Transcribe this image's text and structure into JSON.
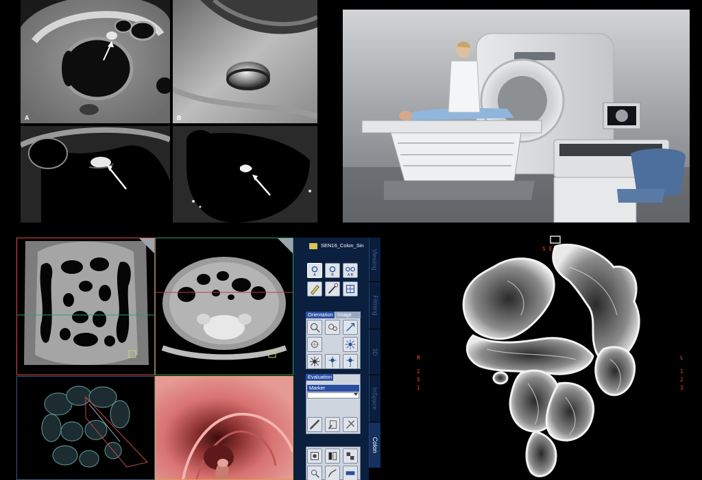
{
  "top_left_panels": {
    "label_a": "A",
    "label_b": "B"
  },
  "viewer": {
    "series_name": "SEN16_Colon_Sin",
    "tabs": [
      "Viewing",
      "Filming",
      "3D",
      "InSpace",
      "Colon"
    ],
    "active_tab": "Colon",
    "tool_labels": {
      "a": "A",
      "b": "B",
      "ab": "A B"
    },
    "section_tabs": [
      "Orientation",
      "Image"
    ],
    "step_labels": [
      "1",
      "2"
    ],
    "evaluation_header": "Evaluation",
    "marker_label": "Marker"
  },
  "volume_render": {
    "top_label": "S E",
    "left_labels": [
      "R",
      "2",
      "5",
      "1"
    ],
    "right_labels": [
      "L",
      "1",
      "2",
      "3"
    ]
  },
  "colors": {
    "background": "#000000",
    "panel_navy": "#0a1d3c",
    "tab_active": "#16315f",
    "marker_bar": "#2b4fa0",
    "coronal_frame": "#e04646",
    "axial_frame": "#2e9e66",
    "endoscopic_frame": "#e0a040",
    "orientation_text": "#b53214"
  }
}
